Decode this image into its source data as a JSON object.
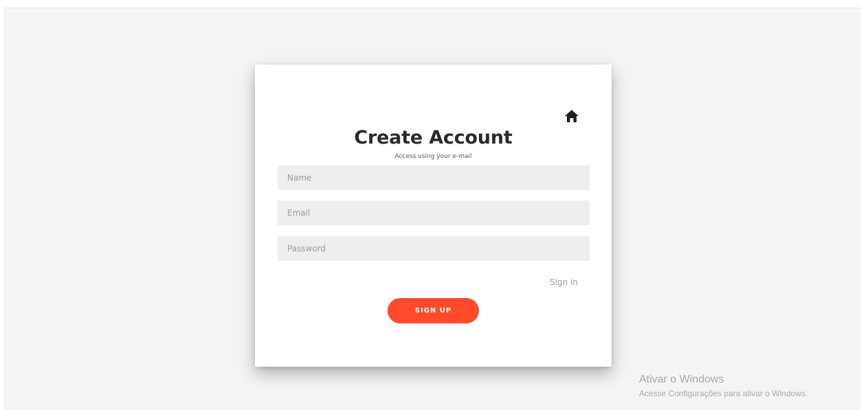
{
  "home_icon": "home-icon",
  "form": {
    "title": "Create Account",
    "subtitle": "Access using your e-mail",
    "name_placeholder": "Name",
    "email_placeholder": "Email",
    "password_placeholder": "Password",
    "signin_label": "Sign in",
    "signup_label": "SIGN UP"
  },
  "colors": {
    "accent": "#ff4b2b",
    "page_background": "#f4f4f6",
    "input_background": "#eeeeee",
    "title_text": "#2c2c30"
  },
  "windows_watermark": {
    "title": "Ativar o Windows",
    "subtitle": "Acesse Configurações para ativar o Windows."
  }
}
